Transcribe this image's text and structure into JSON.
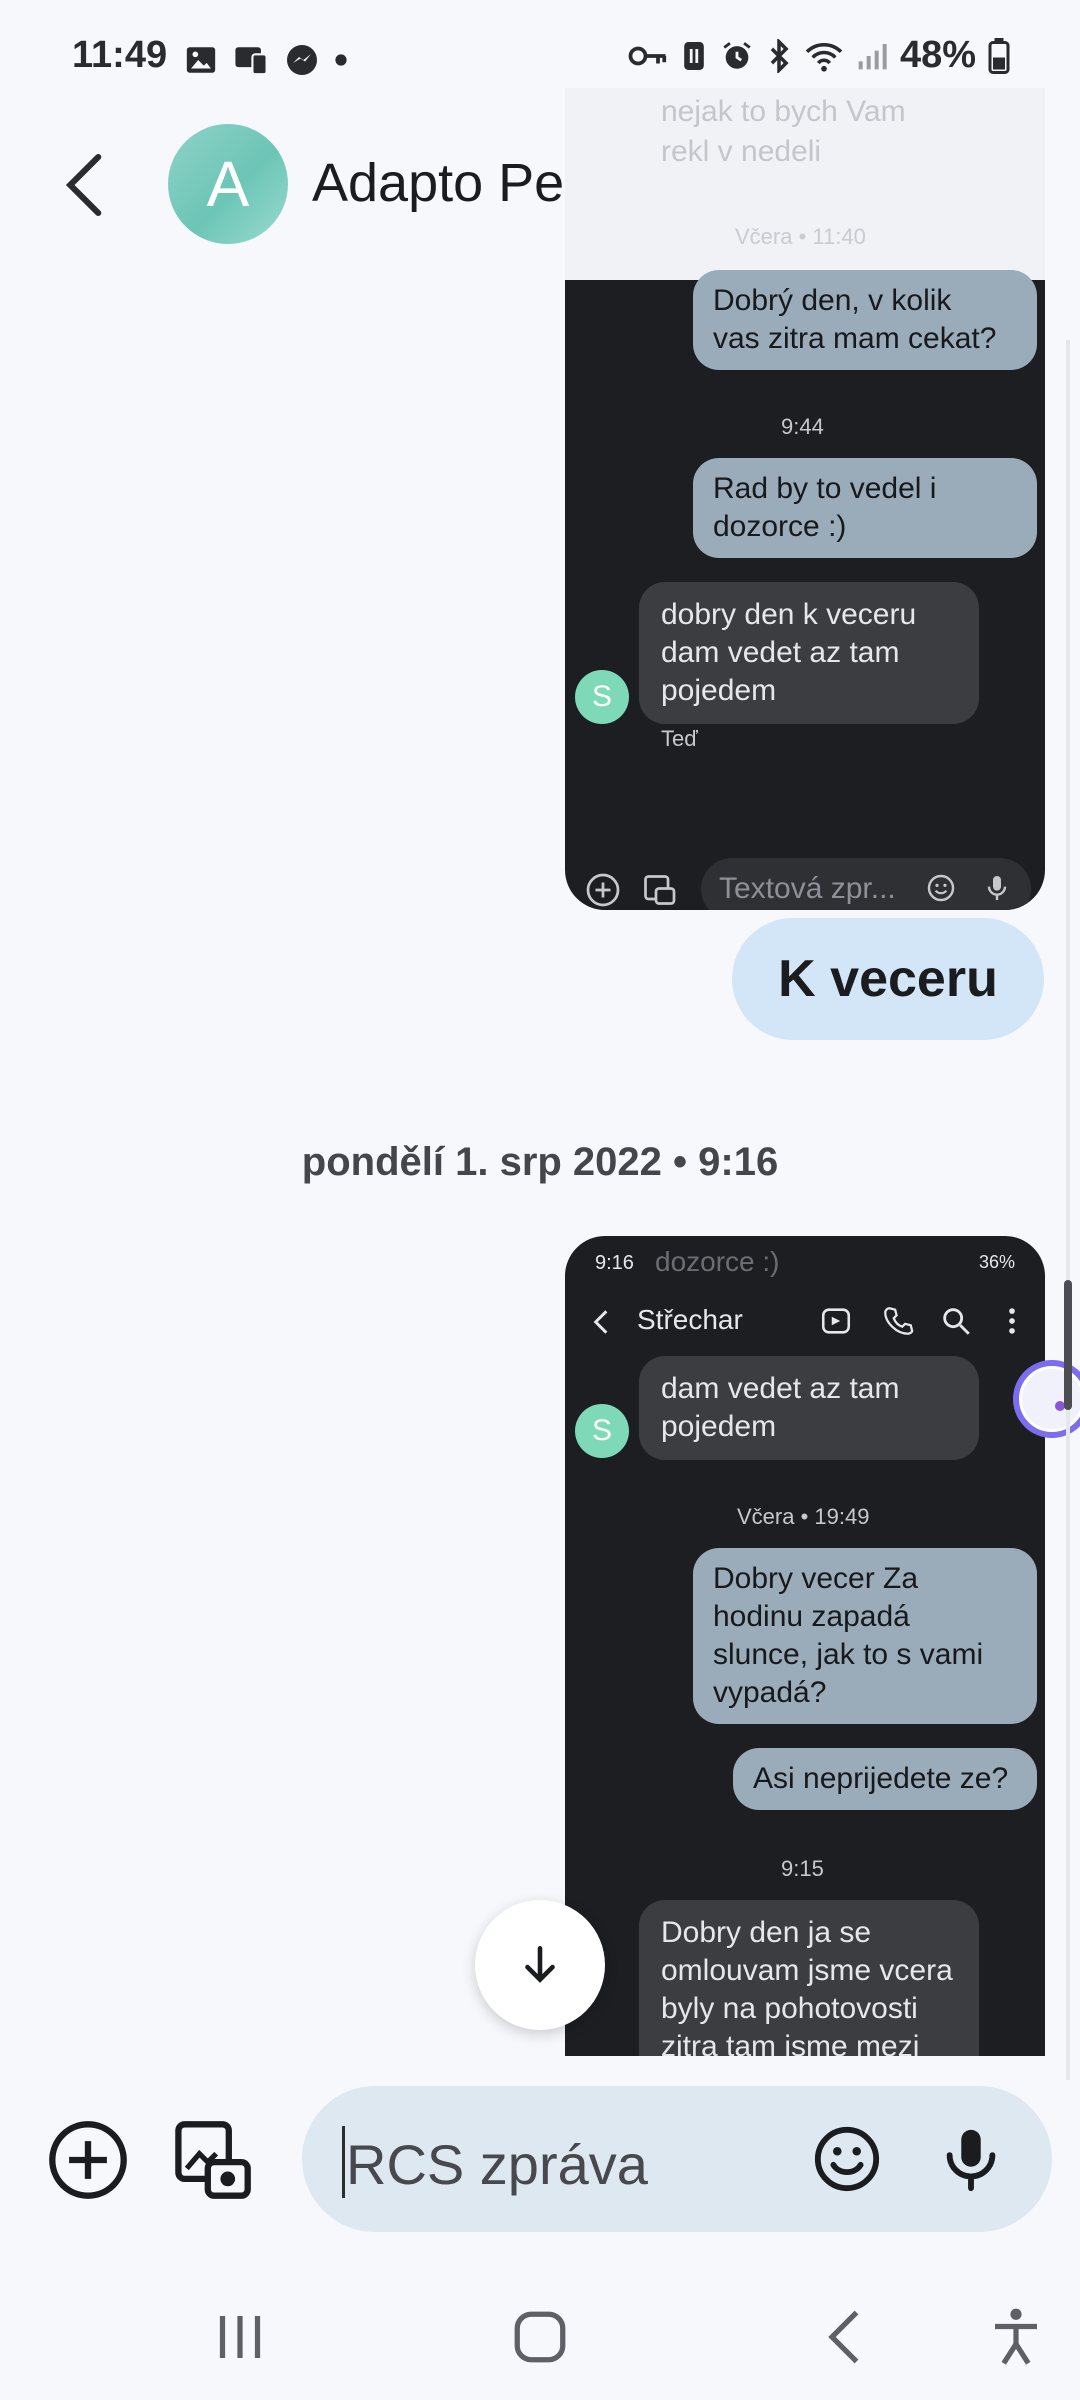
{
  "status_bar": {
    "time": "11:49",
    "battery": "48%"
  },
  "header": {
    "avatar_letter": "A",
    "contact_name": "Adapto Pepik"
  },
  "shot_a": {
    "faded_text": "nejak to bych Vam\nrekl v nedeli",
    "faded_time": "Včera • 11:40",
    "msg1": "Dobrý den,  v kolik\nvas zitra mam cekat?",
    "time1": "9:44",
    "msg2": "Rad by to vedel i\ndozorce :)",
    "msg3": "dobry den k veceru\ndam vedet az tam\npojedem",
    "avatar": "S",
    "msg3_time": "Teď",
    "composer_placeholder": "Textová zpr..."
  },
  "main_bubble": "K veceru",
  "date_separator": "pondělí 1. srp 2022 • 9:16",
  "shot_b": {
    "status_time": "9:16",
    "battery": "36%",
    "contact": "Střechar",
    "faded_top": "dozorce :)",
    "msg1": "dam vedet az tam\npojedem",
    "avatar": "S",
    "time1": "Včera • 19:49",
    "msg2": "Dobry vecer Za\nhodinu zapadá\nslunce, jak to s vami\nvypadá?",
    "msg3": "Asi neprijedete ze?",
    "time2": "9:15",
    "msg4": "Dobry den ja se\nomlouvam jsme vcera\nbyly na pohotovosti\nzitra tam jsme mezi"
  },
  "composer": {
    "placeholder": "RCS zpráva"
  }
}
